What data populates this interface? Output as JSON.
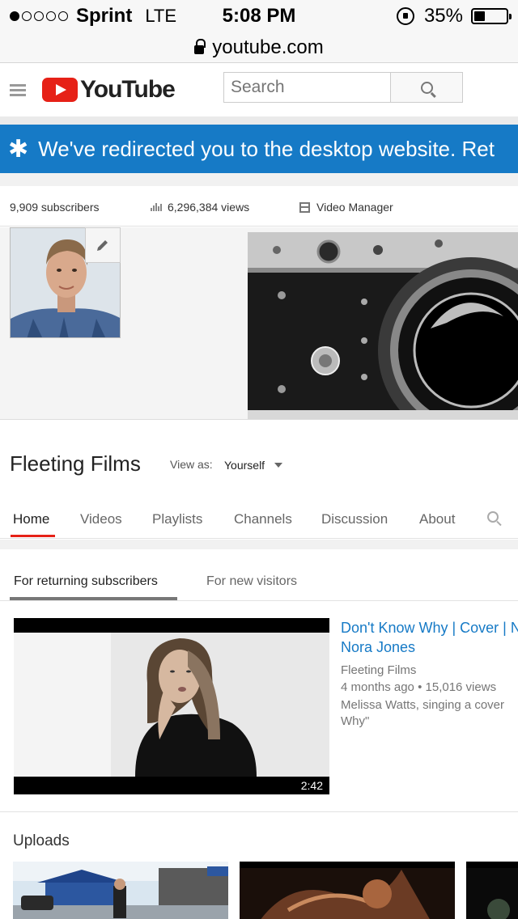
{
  "status_bar": {
    "signal_filled": 1,
    "signal_total": 5,
    "carrier": "Sprint",
    "network": "LTE",
    "time": "5:08 PM",
    "battery_percent": "35%",
    "battery_level": 0.35
  },
  "url_bar": {
    "url": "youtube.com"
  },
  "header": {
    "logo": "YouTube",
    "search_placeholder": "Search",
    "brand_color": "#e62117"
  },
  "banner": {
    "text": "We've redirected you to the desktop website. Ret",
    "color": "#167ac6"
  },
  "stats": {
    "subscribers": "9,909 subscribers",
    "views": "6,296,384 views",
    "video_manager": "Video Manager"
  },
  "channel": {
    "name": "Fleeting Films",
    "view_as_label": "View as:",
    "view_as_value": "Yourself"
  },
  "tabs": [
    {
      "label": "Home",
      "active": true
    },
    {
      "label": "Videos"
    },
    {
      "label": "Playlists"
    },
    {
      "label": "Channels"
    },
    {
      "label": "Discussion"
    },
    {
      "label": "About"
    }
  ],
  "subtabs": [
    {
      "label": "For returning subscribers",
      "active": true
    },
    {
      "label": "For new visitors"
    }
  ],
  "featured": {
    "title_line1": "Don't Know Why | Cover | N",
    "title_line2": "Nora Jones",
    "channel": "Fleeting Films",
    "age": "4 months ago",
    "separator": "•",
    "views": "15,016 views",
    "desc_line1": "Melissa Watts, singing a cover",
    "desc_line2": "Why\"",
    "duration": "2:42"
  },
  "uploads": {
    "title": "Uploads"
  }
}
